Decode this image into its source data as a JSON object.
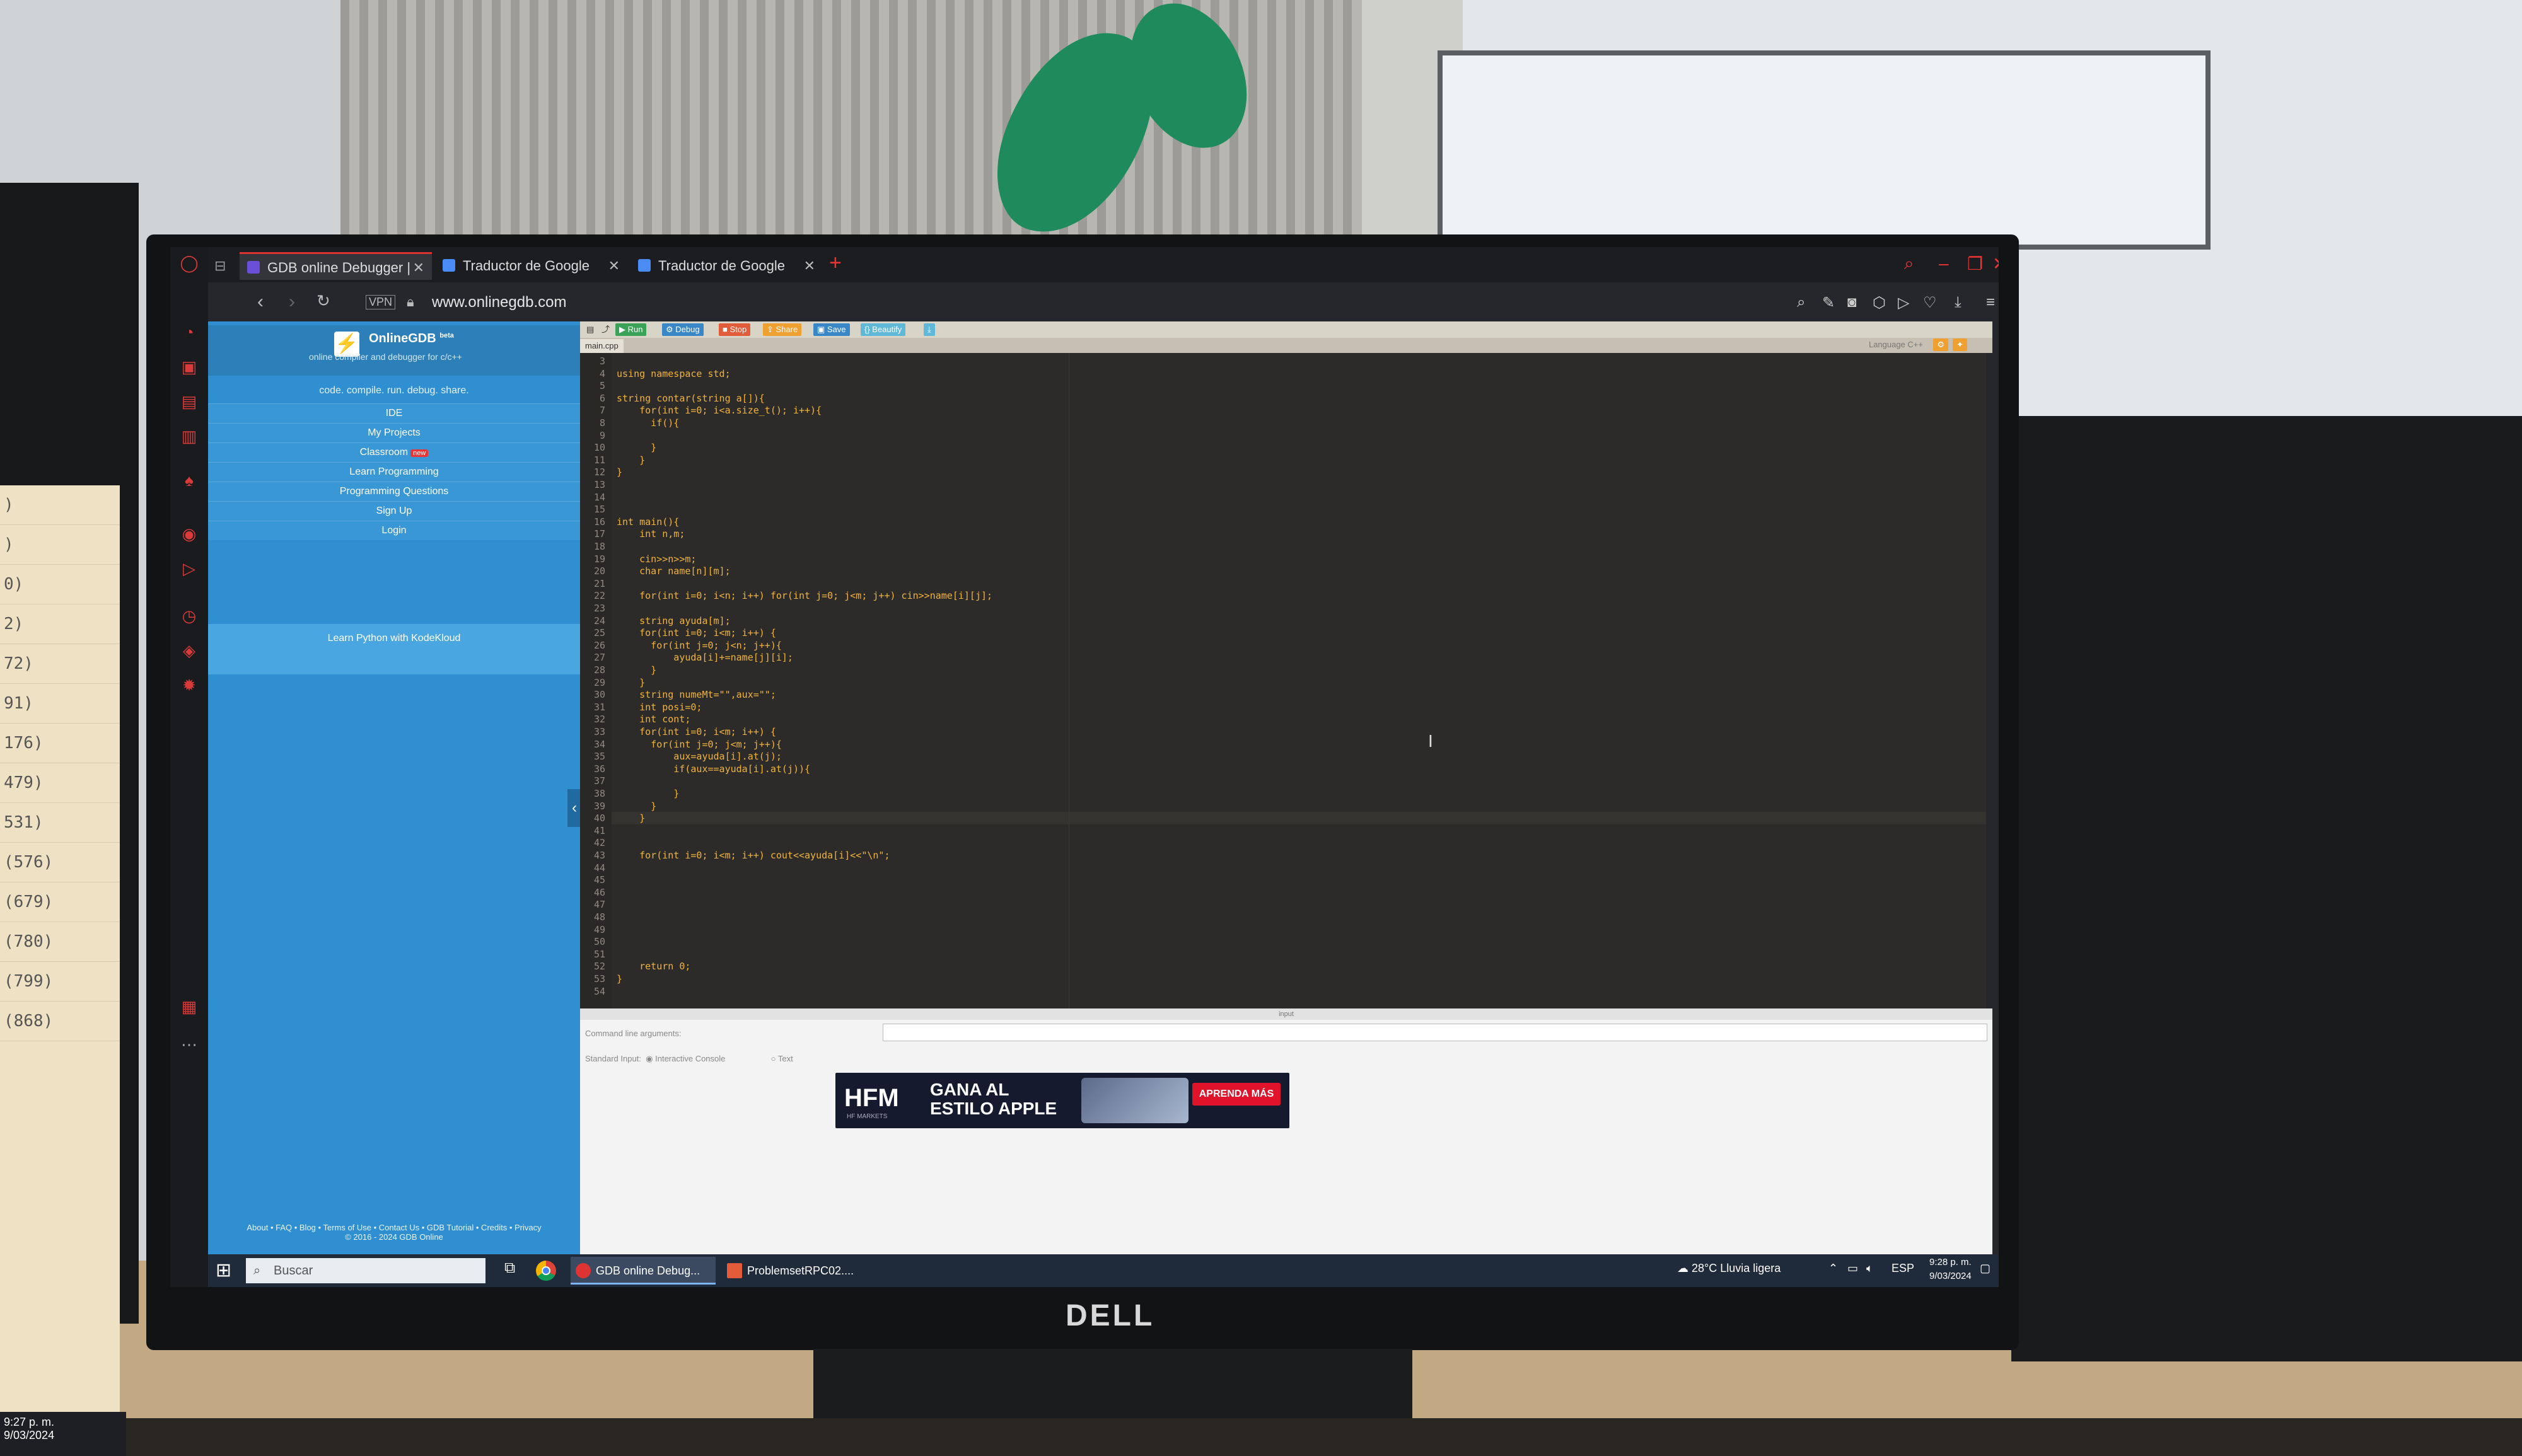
{
  "browser": {
    "tabs": [
      {
        "label": "GDB online Debugger | Co"
      },
      {
        "label": "Traductor de Google"
      },
      {
        "label": "Traductor de Google"
      }
    ],
    "url": "www.onlinegdb.com",
    "vpn": "VPN"
  },
  "gdb": {
    "brand": "OnlineGDB",
    "beta": "beta",
    "tagline": "online compiler and debugger for c/c++",
    "motto": "code. compile. run. debug. share.",
    "menu": [
      "IDE",
      "My Projects",
      "Classroom",
      "Learn Programming",
      "Programming Questions",
      "Sign Up",
      "Login"
    ],
    "new_badge": "new",
    "promo": "Learn Python with KodeKloud",
    "footer_links": "About • FAQ • Blog • Terms of Use • Contact Us • GDB Tutorial • Credits • Privacy",
    "footer_copy": "© 2016 - 2024 GDB Online"
  },
  "toolbar": {
    "run": "Run",
    "debug": "Debug",
    "stop": "Stop",
    "share": "Share",
    "save": "Save",
    "beautify": "{} Beautify",
    "file": "main.cpp",
    "language": "Language  C++"
  },
  "code": [
    {
      "n": "3",
      "t": ""
    },
    {
      "n": "4",
      "t": "using namespace std;"
    },
    {
      "n": "5",
      "t": ""
    },
    {
      "n": "6",
      "t": "string contar(string a[]){"
    },
    {
      "n": "7",
      "t": "    for(int i=0; i<a.size_t(); i++){"
    },
    {
      "n": "8",
      "t": "      if(){"
    },
    {
      "n": "9",
      "t": ""
    },
    {
      "n": "10",
      "t": "      }"
    },
    {
      "n": "11",
      "t": "    }"
    },
    {
      "n": "12",
      "t": "}"
    },
    {
      "n": "13",
      "t": ""
    },
    {
      "n": "14",
      "t": ""
    },
    {
      "n": "15",
      "t": ""
    },
    {
      "n": "16",
      "t": "int main(){"
    },
    {
      "n": "17",
      "t": "    int n,m;"
    },
    {
      "n": "18",
      "t": ""
    },
    {
      "n": "19",
      "t": "    cin>>n>>m;"
    },
    {
      "n": "20",
      "t": "    char name[n][m];"
    },
    {
      "n": "21",
      "t": ""
    },
    {
      "n": "22",
      "t": "    for(int i=0; i<n; i++) for(int j=0; j<m; j++) cin>>name[i][j];"
    },
    {
      "n": "23",
      "t": ""
    },
    {
      "n": "24",
      "t": "    string ayuda[m];"
    },
    {
      "n": "25",
      "t": "    for(int i=0; i<m; i++) {"
    },
    {
      "n": "26",
      "t": "      for(int j=0; j<n; j++){"
    },
    {
      "n": "27",
      "t": "          ayuda[i]+=name[j][i];"
    },
    {
      "n": "28",
      "t": "      }"
    },
    {
      "n": "29",
      "t": "    }"
    },
    {
      "n": "30",
      "t": "    string numeMt=\"\",aux=\"\";"
    },
    {
      "n": "31",
      "t": "    int posi=0;"
    },
    {
      "n": "32",
      "t": "    int cont;"
    },
    {
      "n": "33",
      "t": "    for(int i=0; i<m; i++) {"
    },
    {
      "n": "34",
      "t": "      for(int j=0; j<m; j++){"
    },
    {
      "n": "35",
      "t": "          aux=ayuda[i].at(j);"
    },
    {
      "n": "36",
      "t": "          if(aux==ayuda[i].at(j)){"
    },
    {
      "n": "37",
      "t": ""
    },
    {
      "n": "38",
      "t": "          }"
    },
    {
      "n": "39",
      "t": "      }"
    },
    {
      "n": "40",
      "t": "    }"
    },
    {
      "n": "41",
      "t": ""
    },
    {
      "n": "42",
      "t": ""
    },
    {
      "n": "43",
      "t": "    for(int i=0; i<m; i++) cout<<ayuda[i]<<\"\\n\";"
    },
    {
      "n": "44",
      "t": ""
    },
    {
      "n": "45",
      "t": ""
    },
    {
      "n": "46",
      "t": ""
    },
    {
      "n": "47",
      "t": ""
    },
    {
      "n": "48",
      "t": ""
    },
    {
      "n": "49",
      "t": ""
    },
    {
      "n": "50",
      "t": ""
    },
    {
      "n": "51",
      "t": ""
    },
    {
      "n": "52",
      "t": "    return 0;"
    },
    {
      "n": "53",
      "t": "}"
    },
    {
      "n": "54",
      "t": ""
    }
  ],
  "io": {
    "header": "input",
    "cla_label": "Command line arguments:",
    "stdin_label": "Standard Input:",
    "interactive": "Interactive Console",
    "text": "Text"
  },
  "ad": {
    "brand": "HFM",
    "sub": "HF MARKETS",
    "headline": "GANA AL ESTILO APPLE",
    "cta": "APRENDA MÁS"
  },
  "taskbar": {
    "search_placeholder": "Buscar",
    "apps": [
      {
        "label": "GDB online Debug..."
      },
      {
        "label": "ProblemsetRPC02...."
      }
    ],
    "weather": "28°C  Lluvia ligera",
    "lang": "ESP",
    "time": "9:28 p. m.",
    "date": "9/03/2024"
  },
  "left_monitor": {
    "lines": [
      ")",
      ")",
      "0)",
      "2)",
      "72)",
      "91)",
      "176)",
      "479)",
      "531)",
      "(576)",
      "(679)",
      "(780)",
      "(799)",
      "(868)"
    ],
    "time": "9:27 p. m.",
    "date": "9/03/2024"
  },
  "monitor_logo": "DELL",
  "colors": {
    "code_text": "#f0b43c",
    "sidebar": "#2f8fd0",
    "accent_red": "#dd3333"
  }
}
